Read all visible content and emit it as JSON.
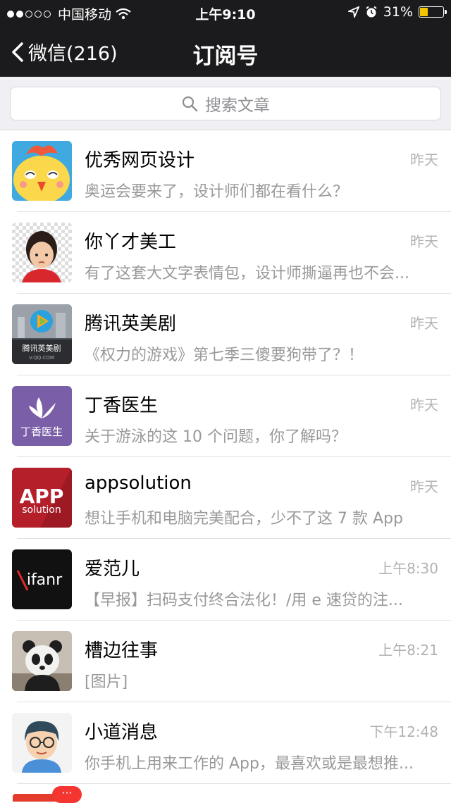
{
  "status_bar": {
    "carrier": "中国移动",
    "time": "上午9:10",
    "battery": "31%",
    "battery_level": 0.31
  },
  "nav": {
    "back_label": "微信(216)",
    "title": "订阅号"
  },
  "search": {
    "placeholder": "搜索文章"
  },
  "items": [
    {
      "name": "优秀网页设计",
      "time": "昨天",
      "preview": "奥运会要来了，设计师们都在看什么？"
    },
    {
      "name": "你丫才美工",
      "time": "昨天",
      "preview": "有了这套大文字表情包，设计师撕逼再也不会..."
    },
    {
      "name": "腾讯英美剧",
      "time": "昨天",
      "preview": "《权力的游戏》第七季三傻要狗带了？！"
    },
    {
      "name": "丁香医生",
      "time": "昨天",
      "preview": "关于游泳的这 10 个问题，你了解吗？"
    },
    {
      "name": "appsolution",
      "time": "昨天",
      "preview": "想让手机和电脑完美配合，少不了这 7 款 App"
    },
    {
      "name": "爱范儿",
      "time": "上午8:30",
      "preview": "【早报】扫码支付终合法化！/用 e 速贷的注..."
    },
    {
      "name": "槽边往事",
      "time": "上午8:21",
      "preview": "[图片]"
    },
    {
      "name": "小道消息",
      "time": "下午12:48",
      "preview": "你手机上用来工作的 App，最喜欢或是最想推..."
    }
  ],
  "avatars": {
    "tencent_text": "腾讯英美剧",
    "tencent_sub": "V.QQ.COM",
    "dingxiang_text": "丁香医生",
    "app_big": "APP",
    "app_small": "solution",
    "ifanr": "ifanr"
  },
  "badge": "···",
  "colors": {
    "nav_bg": "#1b1b1d",
    "search_bg": "#efeff4",
    "badge": "#f43530"
  }
}
